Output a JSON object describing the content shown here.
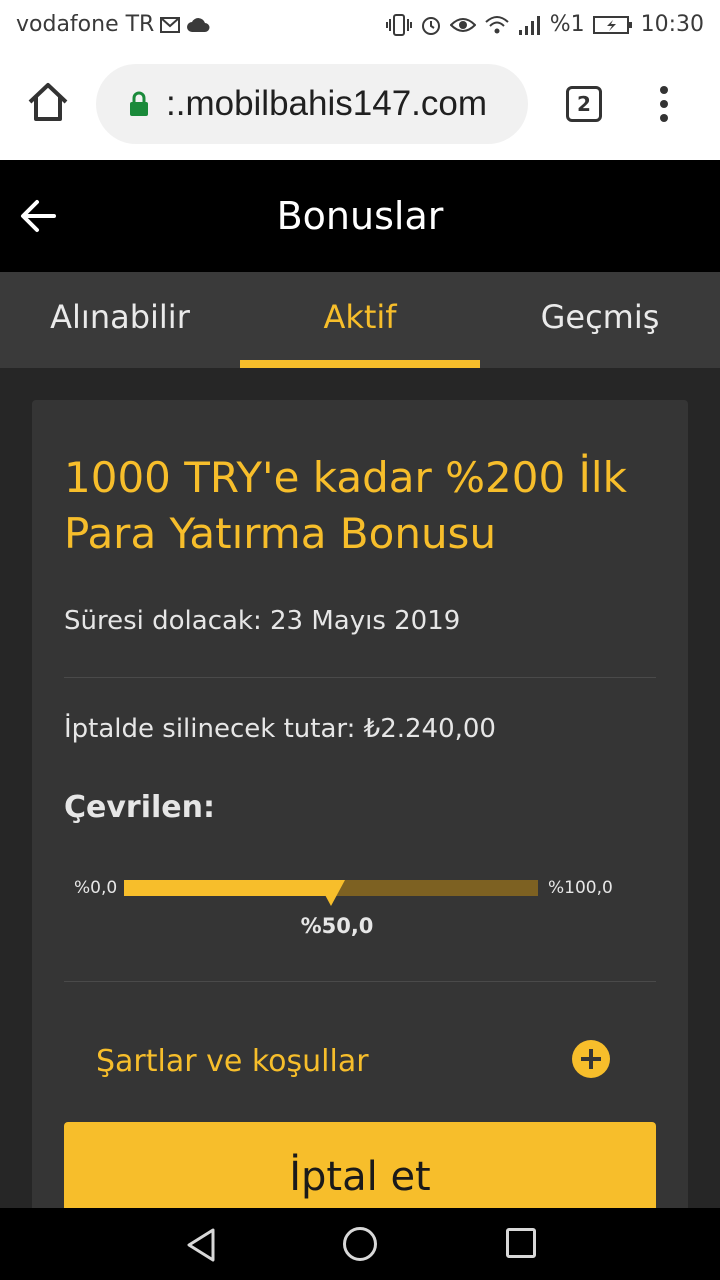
{
  "status_bar": {
    "carrier": "vodafone TR",
    "battery_text": "%1",
    "time": "10:30",
    "icons": [
      "mail-icon",
      "cloud-icon",
      "vibrate-icon",
      "alarm-icon",
      "eye-icon",
      "wifi-icon",
      "signal-icon",
      "battery-charging-icon"
    ]
  },
  "browser": {
    "url": ":.mobilbahis147.com",
    "tab_count": "2"
  },
  "header": {
    "title": "Bonuslar"
  },
  "tabs": [
    {
      "label": "Alınabilir",
      "active": false
    },
    {
      "label": "Aktif",
      "active": true
    },
    {
      "label": "Geçmiş",
      "active": false
    }
  ],
  "bonus": {
    "title": "1000 TRY'e kadar %200 İlk Para Yatırma Bonusu",
    "expiry": "Süresi dolacak: 23 Mayıs 2019",
    "cancel_amount": "İptalde silinecek tutar: ₺2.240,00",
    "converted_label": "Çevrilen:",
    "progress": {
      "min_label": "%0,0",
      "max_label": "%100,0",
      "value_label": "%50,0",
      "fraction": 0.5
    },
    "terms_label": "Şartlar ve koşullar",
    "cancel_button": "İptal et"
  },
  "colors": {
    "accent": "#f7be2b",
    "card_bg": "#353535",
    "tab_bg": "#3a3a3a",
    "page_bg": "#262626"
  }
}
